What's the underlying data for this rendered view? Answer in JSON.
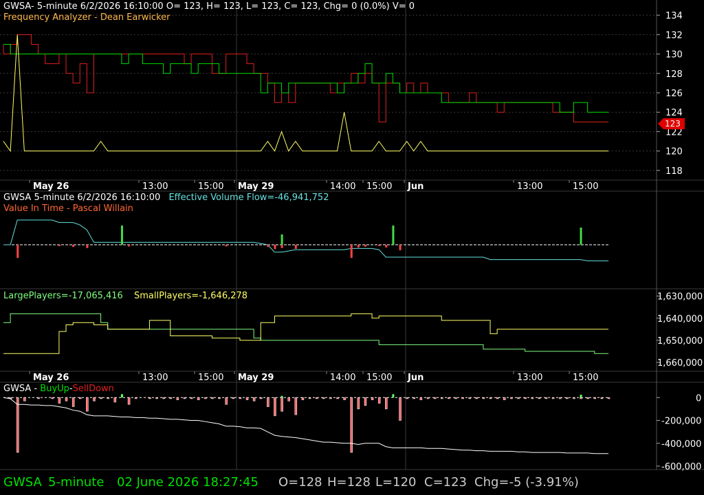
{
  "colors": {
    "green": "#00e000",
    "red": "#e02020",
    "yellow": "#ffff66",
    "cyan": "#66e0e0",
    "lightgreen": "#80ff80",
    "orange": "#ff9933",
    "darkred": "#c00000"
  },
  "panel1": {
    "header": "GWSA- 5-minute 6/2/2026 16:10:00 O= 123, H= 123, L= 123, C= 123, Chg= 0 (0.0%) V= 0",
    "subtitle": "Frequency Analyzer - Dean Earwicker",
    "price_tag": "123"
  },
  "panel2": {
    "header_prefix": "GWSA 5-minute  6/2/2026 16:10:00",
    "header_flow": "Effective Volume Flow=-46,941,752",
    "subtitle": "Value In Time - Pascal Willain"
  },
  "panel3": {
    "large": "LargePlayers=-17,065,416",
    "small": "SmallPlayers=-1,646,278"
  },
  "panel4": {
    "ticker": "GWSA - ",
    "buy": "BuyUp",
    "sep": "-",
    "sell": "SellDown"
  },
  "status": {
    "symbol": "GWSA",
    "interval": "5-minute",
    "datetime": "02 June 2026 18:27:45",
    "open": "O=128",
    "high": "H=128",
    "low": "L=120",
    "close": "C=123",
    "change": "Chg=-5 (-3.91%)"
  },
  "chart_data": [
    {
      "type": "line",
      "title": "Frequency Analyzer - Dean Earwicker",
      "ylim": [
        117,
        135
      ],
      "yticks": [
        118,
        120,
        122,
        124,
        126,
        128,
        130,
        132,
        134
      ],
      "x_labels": [
        "May 26",
        "13:00",
        "15:00",
        "May 29",
        "14:00",
        "15:00",
        "Jun",
        "13:00",
        "15:00"
      ],
      "series": [
        {
          "color": "#ffff66",
          "values": [
            121,
            120,
            132,
            120,
            120,
            120,
            120,
            120,
            120,
            120,
            120,
            120,
            120,
            120,
            121,
            120,
            120,
            120,
            120,
            120,
            120,
            120,
            120,
            120,
            120,
            120,
            120,
            120,
            120,
            120,
            120,
            120,
            120,
            120,
            120,
            120,
            120,
            120,
            121,
            120,
            122,
            120,
            121,
            120,
            120,
            120,
            120,
            120,
            120,
            124,
            120,
            120,
            120,
            120,
            121,
            120,
            120,
            120,
            121,
            120,
            121,
            120,
            120,
            120,
            120,
            120,
            120,
            120,
            120,
            120,
            120,
            120,
            120,
            120,
            120,
            120,
            120,
            120,
            120,
            120,
            120,
            120,
            120,
            120,
            120,
            120,
            120,
            120
          ]
        },
        {
          "color": "#e02020",
          "values": [
            131,
            130,
            131,
            132,
            132,
            131,
            130,
            129,
            129,
            130,
            128,
            127,
            129,
            126,
            130,
            130,
            130,
            130,
            130,
            130,
            130,
            130,
            130,
            130,
            130,
            130,
            130,
            129,
            130,
            130,
            130,
            128,
            128,
            130,
            130,
            130,
            129,
            128,
            128,
            127,
            125,
            126,
            125,
            127,
            127,
            127,
            127,
            127,
            126,
            127,
            127,
            128,
            127,
            128,
            127,
            123,
            127,
            127,
            126,
            127,
            126,
            127,
            126,
            126,
            126,
            125,
            125,
            125,
            126,
            125,
            125,
            125,
            124,
            125,
            125,
            125,
            125,
            125,
            125,
            125,
            124,
            124,
            124,
            123,
            123,
            123,
            123,
            123
          ]
        },
        {
          "color": "#00e000",
          "values": [
            131,
            131,
            130,
            130,
            130,
            130,
            130,
            130,
            130,
            130,
            130,
            130,
            130,
            130,
            130,
            130,
            130,
            130,
            129,
            130,
            130,
            129,
            129,
            129,
            128,
            129,
            129,
            129,
            128,
            129,
            129,
            129,
            128,
            128,
            128,
            128,
            128,
            128,
            126,
            127,
            127,
            126,
            127,
            127,
            127,
            127,
            127,
            127,
            127,
            126,
            127,
            127,
            128,
            129,
            127,
            127,
            128,
            127,
            126,
            126,
            126,
            126,
            126,
            126,
            125,
            125,
            125,
            125,
            125,
            125,
            125,
            125,
            125,
            125,
            125,
            125,
            125,
            125,
            125,
            125,
            125,
            124,
            124,
            125,
            125,
            124,
            124,
            124
          ]
        }
      ],
      "last_value": 123
    },
    {
      "type": "line",
      "title": "Effective Volume Flow=-46,941,752",
      "series": [
        {
          "name": "Effective Volume Flow",
          "color": "#66e0e0",
          "values": [
            0,
            0,
            1,
            1,
            1,
            1,
            1,
            1,
            0.9,
            0.9,
            0.9,
            0.8,
            0.6,
            0.1,
            0.1,
            0.1,
            0.1,
            0.1,
            0.1,
            0.1,
            0.1,
            0.1,
            0.1,
            0.1,
            0.1,
            0.1,
            0.1,
            0.1,
            0.1,
            0.1,
            0.1,
            0.1,
            0.1,
            0.1,
            0.1,
            0.1,
            0.1,
            0.05,
            0,
            -0.3,
            -0.3,
            -0.25,
            -0.2,
            -0.2,
            -0.2,
            -0.2,
            -0.2,
            -0.2,
            -0.2,
            -0.2,
            -0.15,
            -0.15,
            -0.15,
            -0.15,
            -0.2,
            -0.5,
            -0.5,
            -0.5,
            -0.5,
            -0.5,
            -0.5,
            -0.5,
            -0.5,
            -0.5,
            -0.5,
            -0.5,
            -0.5,
            -0.5,
            -0.5,
            -0.5,
            -0.6,
            -0.6,
            -0.6,
            -0.6,
            -0.6,
            -0.6,
            -0.6,
            -0.6,
            -0.6,
            -0.6,
            -0.6,
            -0.6,
            -0.6,
            -0.6,
            -0.65,
            -0.65,
            -0.65,
            -0.65
          ]
        }
      ]
    },
    {
      "type": "line",
      "ylim": [
        1664000,
        1627000
      ],
      "yticks": [
        1630000,
        1640000,
        1650000,
        1660000
      ],
      "ytick_labels": [
        "1,630,000",
        "1,640,000",
        "1,650,000",
        "1,660,000"
      ],
      "series": [
        {
          "name": "LargePlayers",
          "color": "#80ff80",
          "values": [
            1642000,
            1642000,
            1638000,
            1638000,
            1638000,
            1638000,
            1638000,
            1638000,
            1638000,
            1638000,
            1638000,
            1638000,
            1638000,
            1638000,
            1638000,
            1642000,
            1645000,
            1645000,
            1645000,
            1645000,
            1645000,
            1645000,
            1645000,
            1645000,
            1645000,
            1645000,
            1645000,
            1645000,
            1645000,
            1645000,
            1645000,
            1645000,
            1645000,
            1645000,
            1645000,
            1645000,
            1645000,
            1649000,
            1650000,
            1650000,
            1650000,
            1650000,
            1650000,
            1650000,
            1650000,
            1650000,
            1650000,
            1650000,
            1650000,
            1650000,
            1650000,
            1650000,
            1650000,
            1650000,
            1650000,
            1652000,
            1652000,
            1652000,
            1652000,
            1652000,
            1652000,
            1652000,
            1652000,
            1652000,
            1652000,
            1652000,
            1652000,
            1652000,
            1652000,
            1652000,
            1654000,
            1654000,
            1654000,
            1654000,
            1654000,
            1654000,
            1655000,
            1655000,
            1655000,
            1655000,
            1655000,
            1655000,
            1655000,
            1655000,
            1655000,
            1655000,
            1656000,
            1656000
          ]
        },
        {
          "name": "SmallPlayers",
          "color": "#ffff66",
          "values": [
            1656000,
            1656000,
            1656000,
            1656000,
            1656000,
            1656000,
            1656000,
            1656000,
            1656000,
            1646000,
            1643000,
            1642000,
            1642000,
            1642000,
            1643000,
            1643000,
            1645000,
            1645000,
            1645000,
            1645000,
            1645000,
            1645000,
            1641000,
            1641000,
            1641000,
            1648000,
            1648000,
            1648000,
            1648000,
            1648000,
            1648000,
            1649000,
            1649000,
            1649000,
            1649000,
            1650000,
            1650000,
            1650000,
            1642000,
            1642000,
            1639000,
            1639000,
            1639000,
            1639000,
            1639000,
            1639000,
            1639000,
            1639000,
            1639000,
            1639000,
            1639000,
            1638000,
            1638000,
            1638000,
            1640000,
            1639000,
            1639000,
            1639000,
            1639000,
            1639000,
            1639000,
            1639000,
            1639000,
            1639000,
            1641000,
            1641000,
            1641000,
            1641000,
            1641000,
            1641000,
            1641000,
            1647000,
            1645000,
            1645000,
            1645000,
            1645000,
            1645000,
            1645000,
            1645000,
            1645000,
            1645000,
            1645000,
            1645000,
            1645000,
            1645000,
            1645000,
            1645000,
            1645000
          ]
        }
      ]
    },
    {
      "type": "bar",
      "ylim": [
        -630000,
        110000
      ],
      "yticks": [
        0,
        -200000,
        -400000,
        -600000
      ],
      "ytick_labels": [
        "0",
        "-200,000",
        "-400,000",
        "-600,000"
      ],
      "series": [
        {
          "name": "cumulative",
          "color": "#ffffff",
          "values": [
            0,
            -10000,
            -60000,
            -60000,
            -65000,
            -65000,
            -70000,
            -70000,
            -80000,
            -90000,
            -110000,
            -120000,
            -150000,
            -160000,
            -160000,
            -160000,
            -165000,
            -170000,
            -170000,
            -175000,
            -175000,
            -180000,
            -180000,
            -185000,
            -190000,
            -190000,
            -195000,
            -200000,
            -200000,
            -210000,
            -220000,
            -230000,
            -250000,
            -250000,
            -255000,
            -265000,
            -265000,
            -270000,
            -300000,
            -330000,
            -340000,
            -345000,
            -350000,
            -360000,
            -370000,
            -380000,
            -390000,
            -390000,
            -395000,
            -400000,
            -400000,
            -410000,
            -400000,
            -400000,
            -400000,
            -430000,
            -440000,
            -440000,
            -440000,
            -440000,
            -440000,
            -445000,
            -445000,
            -445000,
            -450000,
            -455000,
            -460000,
            -460000,
            -465000,
            -465000,
            -470000,
            -470000,
            -470000,
            -470000,
            -475000,
            -475000,
            -480000,
            -480000,
            -480000,
            -480000,
            -480000,
            -485000,
            -485000,
            -485000,
            -485000,
            -490000,
            -490000,
            -490000
          ]
        },
        {
          "name": "BuyUp",
          "color": "#66ff66",
          "values": [
            0,
            0,
            0,
            0,
            0,
            0,
            0,
            0,
            0,
            0,
            0,
            0,
            0,
            0,
            0,
            0,
            0,
            30000,
            0,
            0,
            0,
            0,
            0,
            0,
            0,
            0,
            0,
            0,
            0,
            0,
            0,
            0,
            0,
            0,
            0,
            0,
            0,
            0,
            0,
            0,
            15000,
            0,
            0,
            0,
            0,
            0,
            0,
            0,
            0,
            0,
            0,
            0,
            0,
            0,
            0,
            0,
            30000,
            0,
            0,
            0,
            0,
            0,
            0,
            0,
            0,
            0,
            0,
            0,
            0,
            0,
            0,
            0,
            0,
            0,
            0,
            0,
            0,
            0,
            0,
            0,
            0,
            0,
            0,
            25000,
            0,
            0,
            0,
            0
          ]
        },
        {
          "name": "SellDown",
          "color": "#ff6666",
          "values": [
            0,
            -10000,
            -480000,
            -30000,
            0,
            -10000,
            0,
            -10000,
            -50000,
            -30000,
            -80000,
            -10000,
            -120000,
            -30000,
            -10000,
            -10000,
            -40000,
            0,
            -60000,
            -10000,
            0,
            -10000,
            -10000,
            -10000,
            -10000,
            -20000,
            -10000,
            -10000,
            -20000,
            -10000,
            -10000,
            -10000,
            -60000,
            -10000,
            -10000,
            -20000,
            -30000,
            -10000,
            -80000,
            -160000,
            -120000,
            -30000,
            -150000,
            -20000,
            -10000,
            -10000,
            -10000,
            -10000,
            -10000,
            -20000,
            -480000,
            -100000,
            -70000,
            -20000,
            -50000,
            -100000,
            0,
            -200000,
            -10000,
            -10000,
            -20000,
            -10000,
            -10000,
            -10000,
            -10000,
            -10000,
            -10000,
            -10000,
            -10000,
            -10000,
            -10000,
            -10000,
            -20000,
            -10000,
            -10000,
            -10000,
            -10000,
            -10000,
            -10000,
            -10000,
            -10000,
            -10000,
            -10000,
            -10000,
            -10000,
            -10000,
            -10000,
            -10000
          ]
        }
      ]
    }
  ]
}
